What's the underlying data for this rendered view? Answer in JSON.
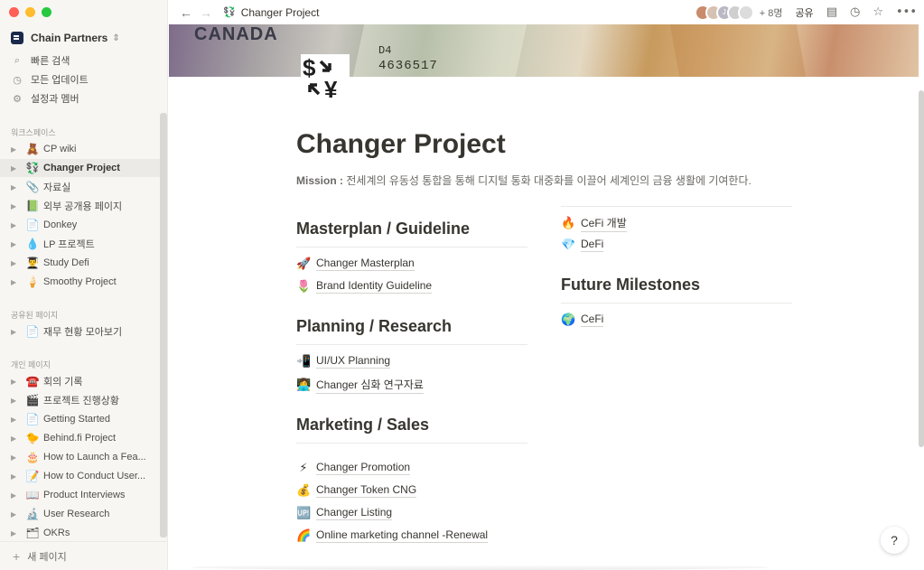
{
  "sidebar": {
    "workspace": "Chain Partners",
    "menu": [
      {
        "icon": "search-icon",
        "glyph": "⌕",
        "label": "빠른 검색"
      },
      {
        "icon": "clock-icon",
        "glyph": "◷",
        "label": "모든 업데이트"
      },
      {
        "icon": "gear-icon",
        "glyph": "⚙",
        "label": "설정과 멤버"
      }
    ],
    "section_workspace": "워크스페이스",
    "workspace_items": [
      {
        "emoji": "🧸",
        "label": "CP wiki"
      },
      {
        "emoji": "💱",
        "label": "Changer Project"
      },
      {
        "emoji": "📎",
        "label": "자료실"
      },
      {
        "emoji": "📗",
        "label": "외부 공개용 페이지"
      },
      {
        "emoji": "📄",
        "label": "Donkey"
      },
      {
        "emoji": "💧",
        "label": "LP 프로젝트"
      },
      {
        "emoji": "👨‍🎓",
        "label": "Study Defi"
      },
      {
        "emoji": "🍦",
        "label": "Smoothy Project"
      }
    ],
    "section_shared": "공유된 페이지",
    "shared_items": [
      {
        "emoji": "📄",
        "label": "재무 현황 모아보기"
      }
    ],
    "section_private": "개인 페이지",
    "private_items": [
      {
        "emoji": "☎️",
        "label": "회의 기록"
      },
      {
        "emoji": "🎬",
        "label": "프로젝트 진행상황"
      },
      {
        "emoji": "📄",
        "label": "Getting Started"
      },
      {
        "emoji": "🐤",
        "label": "Behind.fi Project"
      },
      {
        "emoji": "🎂",
        "label": "How to Launch a Fea..."
      },
      {
        "emoji": "📝",
        "label": "How to Conduct User..."
      },
      {
        "emoji": "📖",
        "label": "Product Interviews"
      },
      {
        "emoji": "🔬",
        "label": "User Research"
      },
      {
        "emoji": "🗂",
        "label": "OKRs"
      }
    ],
    "new_page": "새 페이지"
  },
  "topbar": {
    "breadcrumb_icon": "💱",
    "breadcrumb": "Changer Project",
    "more_members": "+ 8명",
    "share": "공유",
    "avatar_initials": [
      "",
      "",
      "J",
      "",
      ""
    ]
  },
  "cover": {
    "canada": "CANADA",
    "d4": "D4",
    "serial": "4636517"
  },
  "page": {
    "title": "Changer Project",
    "mission_label": "Mission :",
    "mission_text": "전세계의 유동성 통합을 통해 디지털 통화 대중화를 이끌어 세계인의 금융 생활에 기여한다.",
    "sections_left": [
      {
        "heading": "Masterplan / Guideline",
        "links": [
          {
            "emoji": "🚀",
            "label": "Changer Masterplan"
          },
          {
            "emoji": "🌷",
            "label": "Brand Identity Guideline"
          }
        ]
      },
      {
        "heading": "Planning / Research",
        "links": [
          {
            "emoji": "📲",
            "label": "UI/UX Planning"
          },
          {
            "emoji": "👩‍💻",
            "label": "Changer 심화 연구자료"
          }
        ]
      },
      {
        "heading": "Marketing / Sales",
        "links": [
          {
            "emoji": "⚡",
            "label": "Changer Promotion"
          },
          {
            "emoji": "💰",
            "label": "Changer Token CNG"
          },
          {
            "emoji": "🆙",
            "label": "Changer Listing"
          },
          {
            "emoji": "🌈",
            "label": "Online marketing channel -Renewal"
          }
        ]
      }
    ],
    "right_top_links": [
      {
        "emoji": "🔥",
        "label": "CeFi 개발"
      },
      {
        "emoji": "💎",
        "label": "DeFi"
      }
    ],
    "right_section": {
      "heading": "Future Milestones",
      "links": [
        {
          "emoji": "🌍",
          "label": "CeFi"
        }
      ]
    }
  },
  "help": "?"
}
